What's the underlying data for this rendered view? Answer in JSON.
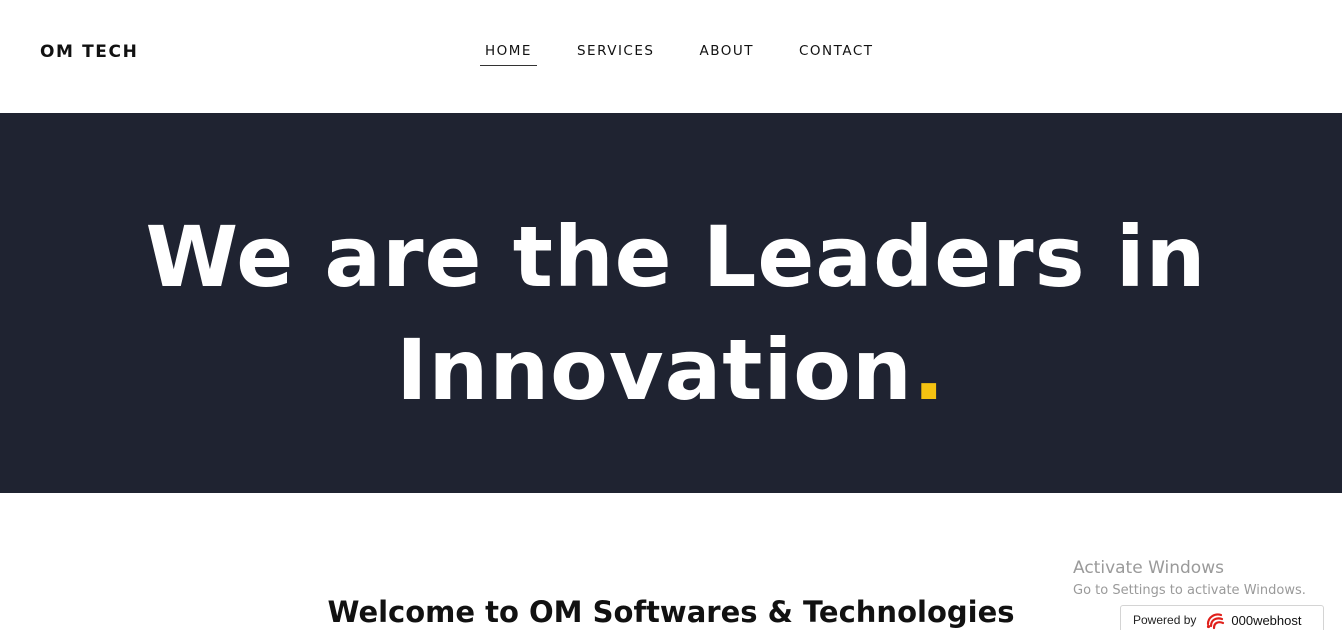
{
  "header": {
    "logo": "OM TECH",
    "nav": [
      {
        "label": "HOME",
        "active": true
      },
      {
        "label": "SERVICES",
        "active": false
      },
      {
        "label": "ABOUT",
        "active": false
      },
      {
        "label": "CONTACT",
        "active": false
      }
    ]
  },
  "hero": {
    "line1": "We are the Leaders  in",
    "line2": "Innovation",
    "dot": ".",
    "background_color": "#1f2331",
    "accent_color": "#f5c211"
  },
  "welcome": {
    "heading": "Welcome to OM Softwares & Technologies"
  },
  "watermark": {
    "title": "Activate Windows",
    "subtitle": "Go to Settings to activate Windows."
  },
  "badge": {
    "label": "Powered by",
    "brand": "000webhost",
    "icon": "000webhost-logo-icon"
  }
}
